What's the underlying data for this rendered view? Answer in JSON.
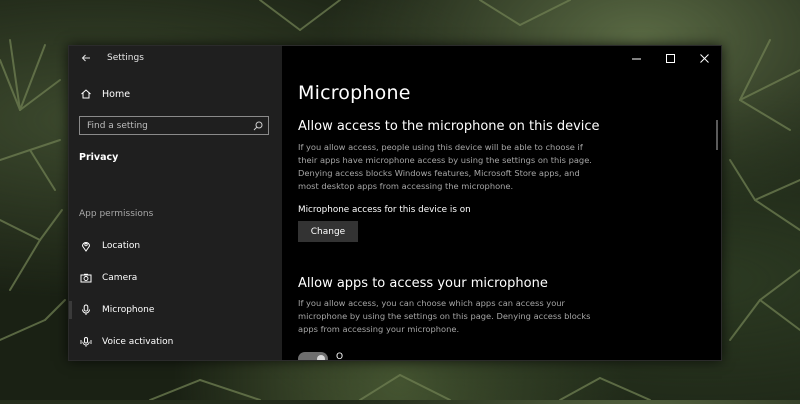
{
  "window": {
    "title": "Settings",
    "controls": [
      "minimize-icon",
      "maximize-icon",
      "close-icon"
    ]
  },
  "sidebar": {
    "home_label": "Home",
    "search_placeholder": "Find a setting",
    "category": "Privacy",
    "section_header": "App permissions",
    "items": [
      {
        "label": "Location",
        "icon": "location-icon"
      },
      {
        "label": "Camera",
        "icon": "camera-icon"
      },
      {
        "label": "Microphone",
        "icon": "microphone-icon"
      },
      {
        "label": "Voice activation",
        "icon": "voice-activation-icon"
      }
    ]
  },
  "main": {
    "title": "Microphone",
    "section1": {
      "heading": "Allow access to the microphone on this device",
      "description": "If you allow access, people using this device will be able to choose if their apps have microphone access by using the settings on this page. Denying access blocks Windows features, Microsoft Store apps, and most desktop apps from accessing the microphone.",
      "status": "Microphone access for this device is on",
      "change_label": "Change"
    },
    "section2": {
      "heading": "Allow apps to access your microphone",
      "description": "If you allow access, you can choose which apps can access your microphone by using the settings on this page. Denying access blocks apps from accessing your microphone.",
      "toggle_label": "O"
    }
  },
  "colors": {
    "window_bg": "#000000",
    "sidebar_bg": "#1f1f1f",
    "button_bg": "#333333",
    "secondary_text": "#a6a6a6"
  }
}
